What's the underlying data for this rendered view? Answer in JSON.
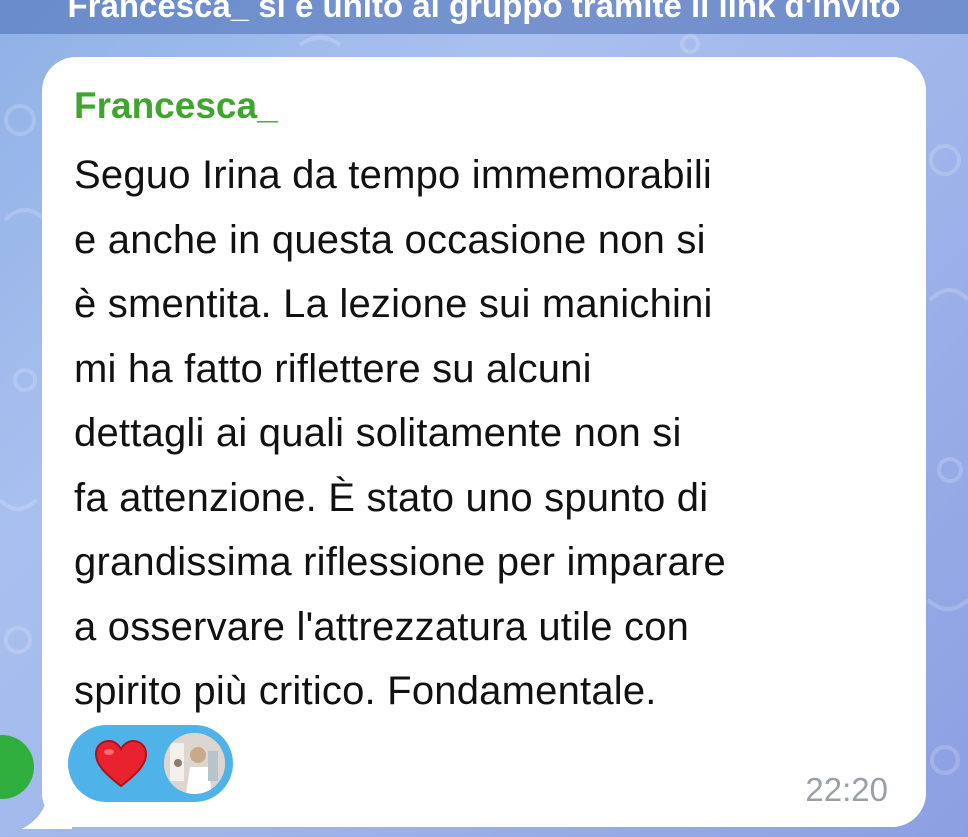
{
  "system_message": "Francesca_ si è unito al gruppo tramite il link d'invito",
  "message": {
    "sender": "Francesca_",
    "lines": [
      "Seguo Irina da tempo immemorabili",
      "e anche in questa occasione non si",
      "è smentita. La lezione sui manichini",
      "mi ha fatto riflettere su alcuni",
      "dettagli ai quali solitamente non si",
      "fa attenzione. È stato uno spunto di",
      "grandissima riflessione per imparare",
      "a osservare l'attrezzatura utile con",
      "spirito più critico. Fondamentale."
    ],
    "time": "22:20",
    "reaction": {
      "emoji_icon": "red-heart-icon",
      "reactor": "reactor-avatar"
    }
  },
  "colors": {
    "sender_name": "#3fa52f",
    "reaction_pill": "#4fb3ea",
    "heart": "#e8232f",
    "timestamp": "#9aa0a8"
  }
}
